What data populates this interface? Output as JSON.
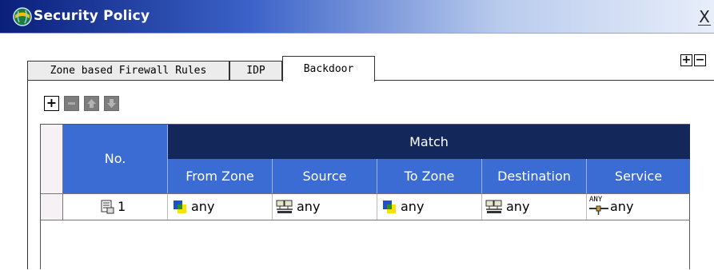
{
  "window": {
    "title": "Security Policy",
    "close_glyph": "X"
  },
  "tabs": [
    {
      "label": "Zone based Firewall Rules"
    },
    {
      "label": "IDP"
    },
    {
      "label": "Backdoor"
    }
  ],
  "expand_controls": {
    "expand": "+",
    "collapse": "−"
  },
  "toolbar": {
    "add": "+",
    "remove_icon": "remove-icon",
    "up_icon": "move-up-icon",
    "down_icon": "move-down-icon"
  },
  "table": {
    "group_header": "Match",
    "no_header": "No.",
    "columns": [
      "From Zone",
      "Source",
      "To Zone",
      "Destination",
      "Service"
    ],
    "rows": [
      {
        "no": "1",
        "from_zone": "any",
        "source": "any",
        "to_zone": "any",
        "destination": "any",
        "service": "any",
        "service_badge": "ANY"
      }
    ]
  },
  "colors": {
    "header_dark": "#13275b",
    "header_blue": "#3b6cd3"
  }
}
